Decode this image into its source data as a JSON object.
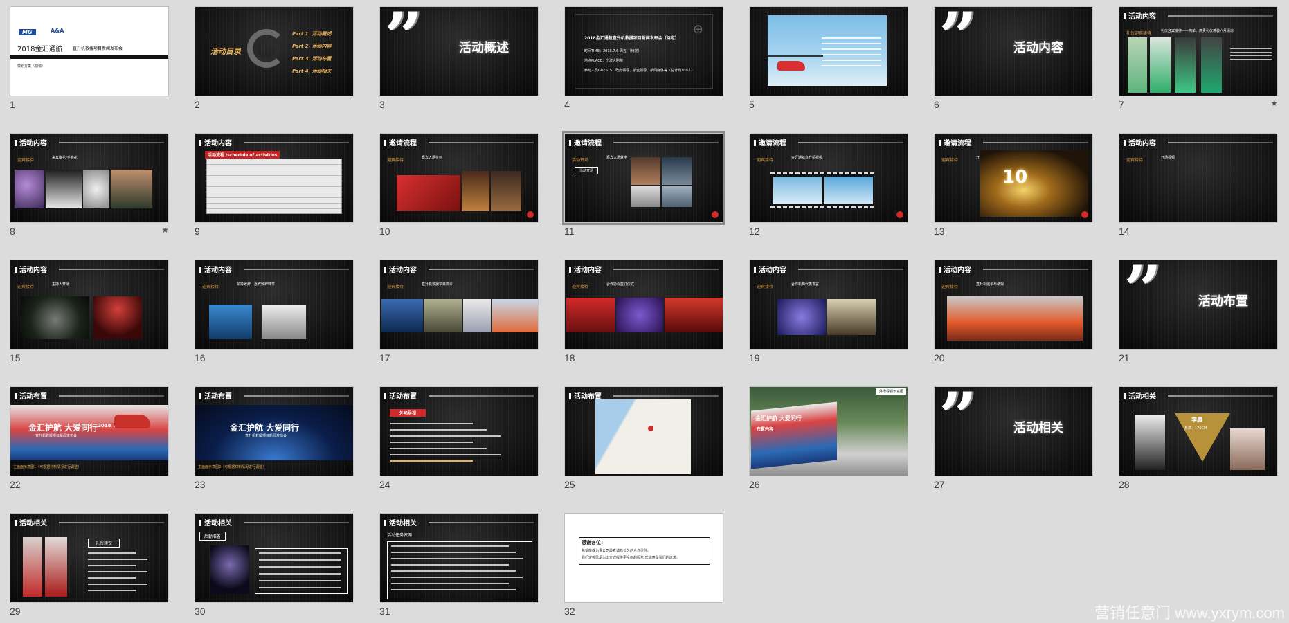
{
  "slides": [
    {
      "num": "1",
      "type": "title",
      "title": "2018金汇通航",
      "subtitle": "直升机救援项目新闻发布会",
      "small": "策划方案（初稿）",
      "logo_left": "MG",
      "logo_right": "A&A"
    },
    {
      "num": "2",
      "type": "agenda",
      "title": "活动目录",
      "parts": [
        "Part 1. 活动概述",
        "Part 2. 活动内容",
        "Part 3. 活动布置",
        "Part 4. 活动相关"
      ]
    },
    {
      "num": "3",
      "type": "section",
      "title": "活动概述"
    },
    {
      "num": "4",
      "type": "overview",
      "title": "2018金汇通航直升机救援项目新闻发布会（待定）",
      "lines": [
        "时间TIME：2018.7.6 周五 （待定）",
        "地点PLACE：宁波大剧院",
        "参与人员GUESTS：政府领导、航空领导、新闻媒体等（总计约100人）"
      ]
    },
    {
      "num": "5",
      "type": "photo_text"
    },
    {
      "num": "6",
      "type": "section",
      "title": "活动内容"
    },
    {
      "num": "7",
      "type": "content",
      "header": "活动内容",
      "tag": "礼仪迎宾接待",
      "text": "礼仪迎宾接待——简单、高贵礼仪着装六月清凉",
      "starred": true
    },
    {
      "num": "8",
      "type": "content",
      "header": "活动内容",
      "tag": "迎宾接待",
      "text": "来宾胸花/手腕花",
      "starred": true
    },
    {
      "num": "9",
      "type": "table",
      "header": "活动内容",
      "table_title": "活动流程 /schedule of activities"
    },
    {
      "num": "10",
      "type": "content",
      "header": "邀请流程",
      "tag": "迎宾接待",
      "text": "嘉宾入场签到"
    },
    {
      "num": "11",
      "type": "content",
      "header": "邀请流程",
      "tag": "活动开场",
      "text": "嘉宾入场就坐",
      "selected": true
    },
    {
      "num": "12",
      "type": "content",
      "header": "邀请流程",
      "tag": "迎宾接待",
      "text": "金汇通航直升机视频"
    },
    {
      "num": "13",
      "type": "content",
      "header": "邀请流程",
      "tag": "迎宾接待",
      "text": "开场倒计时",
      "big_number": "10"
    },
    {
      "num": "14",
      "type": "content",
      "header": "活动内容",
      "tag": "迎宾接待",
      "text": "开场视频"
    },
    {
      "num": "15",
      "type": "content",
      "header": "活动内容",
      "tag": "迎宾接待",
      "text": "主持人开场"
    },
    {
      "num": "16",
      "type": "content",
      "header": "活动内容",
      "tag": "迎宾接待",
      "text": "领导致辞、嘉宾致辞环节"
    },
    {
      "num": "17",
      "type": "content",
      "header": "活动内容",
      "tag": "迎宾接待",
      "text": "直升机救援项目简介"
    },
    {
      "num": "18",
      "type": "content",
      "header": "活动内容",
      "tag": "迎宾接待",
      "text": "合作协议签订仪式"
    },
    {
      "num": "19",
      "type": "content",
      "header": "活动内容",
      "tag": "迎宾接待",
      "text": "合作机构代表发言"
    },
    {
      "num": "20",
      "type": "content",
      "header": "活动内容",
      "tag": "迎宾接待",
      "text": "直升机展示与参观"
    },
    {
      "num": "21",
      "type": "section",
      "title": "活动布置"
    },
    {
      "num": "22",
      "type": "banner",
      "header": "活动布置",
      "banner_title": "金汇护航 大爱同行",
      "banner_sub": "直升机救援项目新闻发布会",
      "date": "2018 7/6",
      "caption": "主画面示意图1（可根据材料情况进行调整）"
    },
    {
      "num": "23",
      "type": "banner_blue",
      "header": "活动布置",
      "banner_title": "金汇护航 大爱同行",
      "banner_sub": "直升机救援项目新闻发布会",
      "caption": "主画面示意图2（可根据材料情况进行调整）"
    },
    {
      "num": "24",
      "type": "list",
      "header": "活动布置",
      "box": "外场导视"
    },
    {
      "num": "25",
      "type": "map",
      "header": "活动布置"
    },
    {
      "num": "26",
      "type": "outdoor",
      "label": "外场导视示意图",
      "banner_title": "金汇护航 大爱同行",
      "sub": "布置内容"
    },
    {
      "num": "27",
      "type": "section",
      "title": "活动相关"
    },
    {
      "num": "28",
      "type": "host",
      "header": "活动相关",
      "name": "李晨",
      "height": "身高：170CM"
    },
    {
      "num": "29",
      "type": "dress",
      "header": "活动相关",
      "box": "礼仪建议"
    },
    {
      "num": "30",
      "type": "list2",
      "header": "活动相关",
      "box": "后勤准备"
    },
    {
      "num": "31",
      "type": "list3",
      "header": "活动相关",
      "box": "活动任务资源"
    },
    {
      "num": "32",
      "type": "thanks",
      "title": "感谢各位!",
      "lines": [
        "希望能成为贵公司最真诚的长久的合作伙伴。",
        "我们定将秉承为出方式提供更全面的服务,您满意是我们的追求。"
      ]
    }
  ],
  "watermark": "营销任意门 www.yxrym.com",
  "colors": {
    "background": "#dcdcdc",
    "accent_orange": "#e5b15a",
    "accent_red": "#d42a2a"
  }
}
